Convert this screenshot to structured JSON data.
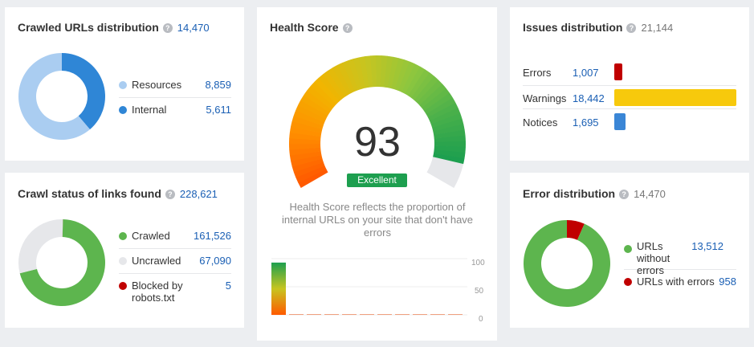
{
  "crawled": {
    "title": "Crawled URLs distribution",
    "total": "14,470",
    "items": [
      {
        "label": "Resources",
        "value": "8,859",
        "color": "#aacdf1"
      },
      {
        "label": "Internal",
        "value": "5,611",
        "color": "#2f86d6"
      }
    ]
  },
  "crawl_status": {
    "title": "Crawl status of links found",
    "total": "228,621",
    "items": [
      {
        "label": "Crawled",
        "value": "161,526",
        "color": "#5db54e"
      },
      {
        "label": "Uncrawled",
        "value": "67,090",
        "color": "#e6e7ea"
      },
      {
        "label": "Blocked by robots.txt",
        "value": "5",
        "color": "#c00000"
      }
    ]
  },
  "health": {
    "title": "Health Score",
    "score": "93",
    "badge": "Excellent",
    "description": "Health Score reflects the proportion of internal URLs on your site that don't have errors",
    "axis": [
      "100",
      "50",
      "0"
    ]
  },
  "issues": {
    "title": "Issues distribution",
    "total": "21,144",
    "items": [
      {
        "label": "Errors",
        "value": "1,007",
        "color": "#c00000"
      },
      {
        "label": "Warnings",
        "value": "18,442",
        "color": "#f7c90c"
      },
      {
        "label": "Notices",
        "value": "1,695",
        "color": "#3a86d6"
      }
    ]
  },
  "errors": {
    "title": "Error distribution",
    "total": "14,470",
    "items": [
      {
        "label": "URLs without errors",
        "value": "13,512",
        "color": "#5db54e"
      },
      {
        "label": "URLs with errors",
        "value": "958",
        "color": "#c00000"
      }
    ]
  },
  "chart_data": [
    {
      "type": "pie",
      "title": "Crawled URLs distribution",
      "categories": [
        "Resources",
        "Internal"
      ],
      "values": [
        8859,
        5611
      ]
    },
    {
      "type": "pie",
      "title": "Crawl status of links found",
      "categories": [
        "Crawled",
        "Uncrawled",
        "Blocked by robots.txt"
      ],
      "values": [
        161526,
        67090,
        5
      ]
    },
    {
      "type": "pie",
      "title": "Issues distribution",
      "categories": [
        "Errors",
        "Warnings",
        "Notices"
      ],
      "values": [
        1007,
        18442,
        1695
      ]
    },
    {
      "type": "pie",
      "title": "Error distribution",
      "categories": [
        "URLs without errors",
        "URLs with errors"
      ],
      "values": [
        13512,
        958
      ]
    },
    {
      "type": "bar",
      "title": "Health Score",
      "ylim": [
        0,
        100
      ],
      "values": [
        93,
        0,
        0,
        0,
        0,
        0,
        0,
        0,
        0,
        0,
        0
      ]
    }
  ]
}
